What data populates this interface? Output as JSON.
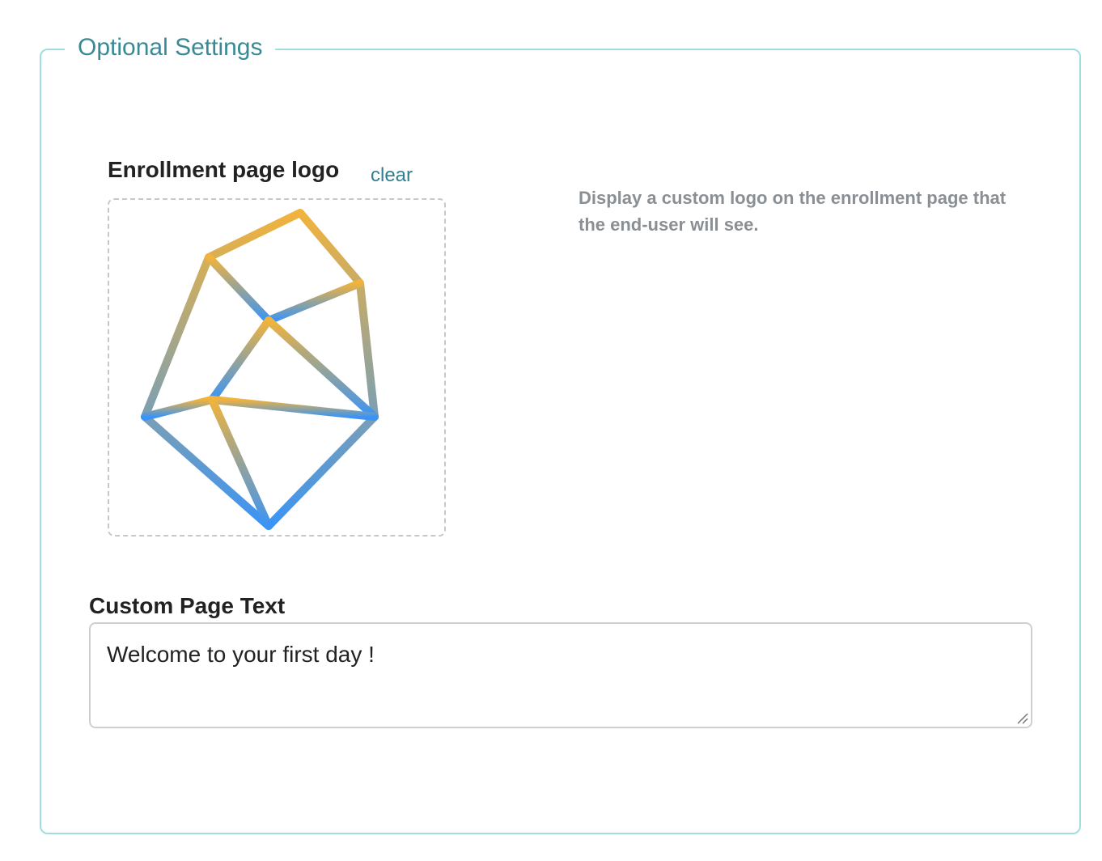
{
  "fieldset": {
    "legend": "Optional Settings",
    "border_color": "#9fdde0",
    "legend_color": "#3a8a96"
  },
  "logo": {
    "label": "Enrollment page logo",
    "clear_label": "clear",
    "help_text": "Display a custom logo on the enrollment page that the end-user will see.",
    "icon": "geometric-polygon-logo",
    "gradient_top": "#f1b33c",
    "gradient_bottom": "#3b94f5"
  },
  "custom_text": {
    "label": "Custom Page Text",
    "value": "Welcome to your first day !"
  }
}
